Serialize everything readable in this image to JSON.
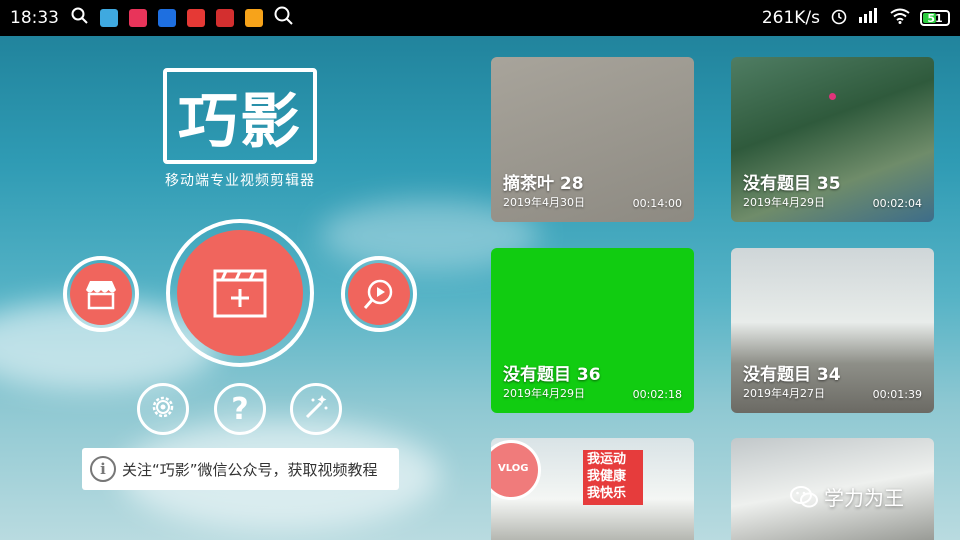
{
  "status_bar": {
    "time": "18:33",
    "net_speed": "261K/s",
    "battery": "51",
    "icons": [
      "search-icon",
      "app-icon-blue",
      "app-icon-red",
      "video-app-icon",
      "news-app-icon",
      "news-app-icon-2",
      "yellow-app-icon",
      "search-icon-2"
    ]
  },
  "logo": {
    "title": "巧影",
    "subtitle": "移动端专业视频剪辑器"
  },
  "main_buttons": {
    "store_icon": "store-icon",
    "new_project_icon": "new-project-clapper-icon",
    "play_icon": "play-search-icon",
    "settings_icon": "gear-icon",
    "help_label": "?",
    "magic_icon": "magic-wand-icon"
  },
  "notice": {
    "text": "关注“巧影”微信公众号，获取视频教程"
  },
  "projects": [
    {
      "title": "摘茶叶 28",
      "date": "2019年4月30日",
      "duration": "00:14:00"
    },
    {
      "title": "没有题目 35",
      "date": "2019年4月29日",
      "duration": "00:02:04"
    },
    {
      "title": "没有题目 36",
      "date": "2019年4月29日",
      "duration": "00:02:18"
    },
    {
      "title": "没有题目 34",
      "date": "2019年4月27日",
      "duration": "00:01:39"
    },
    {
      "title": "",
      "date": "",
      "duration": ""
    },
    {
      "title": "",
      "date": "",
      "duration": ""
    }
  ],
  "thumbnail_text": {
    "vlog": "VLOG",
    "sticker": [
      "我运动",
      "我健康",
      "我快乐"
    ]
  },
  "watermark": {
    "text": "学力为王"
  },
  "colors": {
    "accent": "#f0655d",
    "green_card": "#11cc11"
  }
}
